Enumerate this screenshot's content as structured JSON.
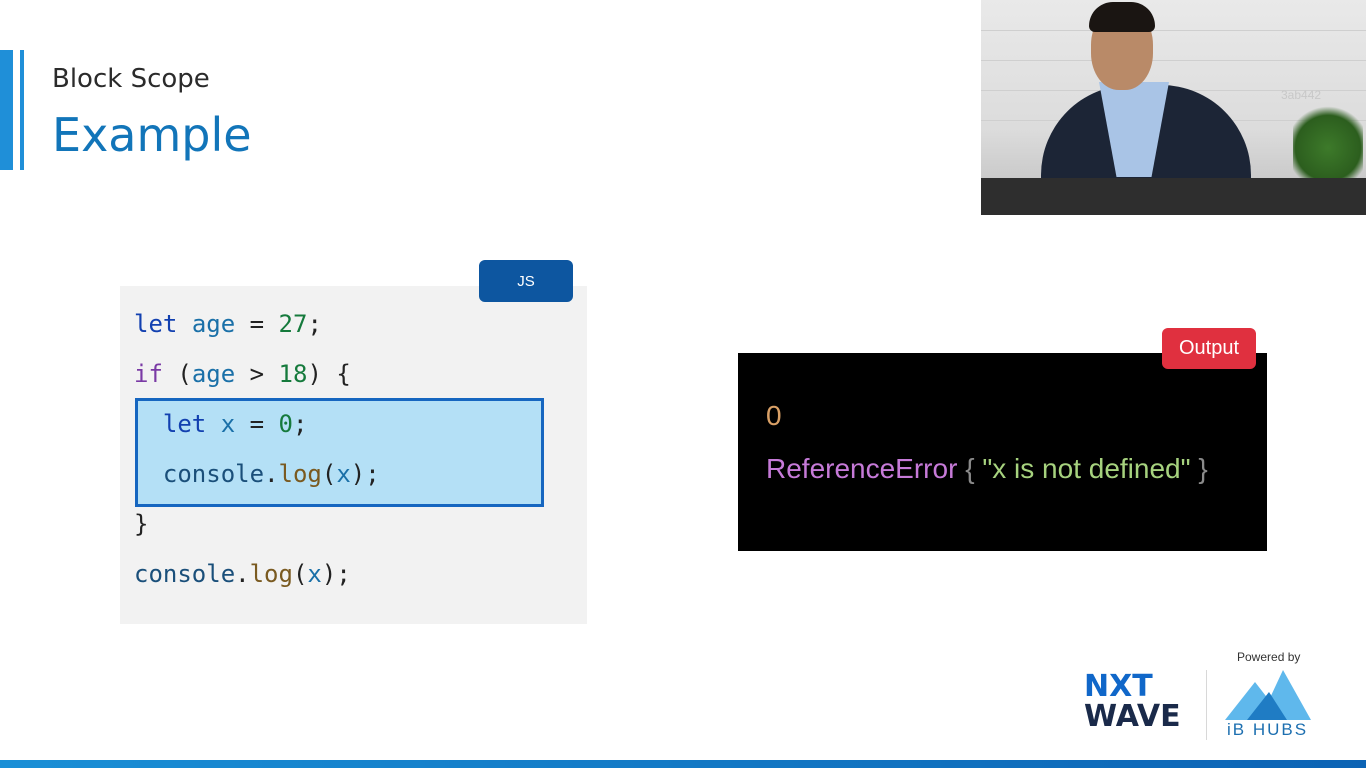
{
  "slide": {
    "subtitle": "Block Scope",
    "title": "Example",
    "accent_color": "#1f8fd8"
  },
  "code": {
    "badge_label": "JS",
    "lines": [
      "let age = 27;",
      "if (age > 18) {",
      "  let x = 0;",
      "  console.log(x);",
      "}",
      "console.log(x);"
    ],
    "highlighted_lines": [
      3,
      4
    ]
  },
  "output": {
    "badge_label": "Output",
    "first_line": "0",
    "error_name": "ReferenceError",
    "error_open": "{",
    "error_message": "\"x is not defined\"",
    "error_close": "}"
  },
  "webcam": {
    "watermark": "3ab442"
  },
  "branding": {
    "powered_by": "Powered by",
    "nxt_line1": "NXT",
    "nxt_line2": "WAVE",
    "ib_hubs": "iB HUBS"
  }
}
